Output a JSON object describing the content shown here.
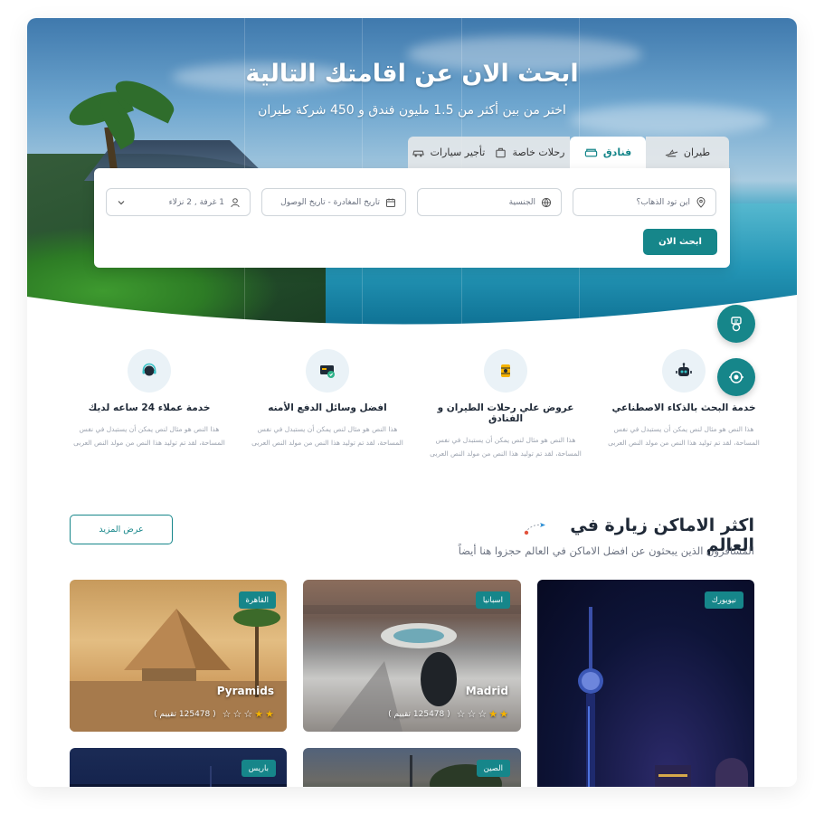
{
  "hero": {
    "title": "ابحث الان عن اقامتك التالية",
    "subtitle": "اختر من بين أكثر من 1.5 مليون فندق و 450 شركة طيران"
  },
  "tabs": [
    {
      "label": "طيران",
      "icon": "plane-icon"
    },
    {
      "label": "فنادق",
      "icon": "hotel-bed-icon",
      "active": true
    },
    {
      "label": "رحلات خاصة",
      "icon": "suitcase-icon"
    },
    {
      "label": "تأجير سيارات",
      "icon": "car-icon"
    }
  ],
  "search": {
    "destination_placeholder": "اين تود الذهاب؟",
    "nationality_placeholder": "الجنسية",
    "dates_placeholder": "تاريخ المغادرة - تاريخ الوصول",
    "rooms_value": "1 غرفة , 2 نزلاء",
    "button_label": "ابحث الان"
  },
  "features": [
    {
      "title": "خدمة البحث بالذكاء الاصطناعي",
      "text": "هذا النص هو مثال لنص يمكن أن يستبدل في نفس المساحة، لقد تم توليد هذا النص من مولد النص العربى",
      "icon": "robot-icon"
    },
    {
      "title": "عروض علي رحلات الطيران و الفنادق",
      "text": "هذا النص هو مثال لنص يمكن أن يستبدل في نفس المساحة، لقد تم توليد هذا النص من مولد النص العربى",
      "icon": "ticket-icon"
    },
    {
      "title": "افضل وسائل الدفع الأمنه",
      "text": "هذا النص هو مثال لنص يمكن أن يستبدل في نفس المساحة، لقد تم توليد هذا النص من مولد النص العربى",
      "icon": "secure-card-icon"
    },
    {
      "title": "خدمة عملاء 24 ساعه لديك",
      "text": "هذا النص هو مثال لنص يمكن أن يستبدل في نفس المساحة، لقد تم توليد هذا النص من مولد النص العربى",
      "icon": "headset-icon"
    }
  ],
  "section": {
    "title": "اكثر الاماكن زيارة في العالم",
    "subtitle": "المسافرون الذين يبحثون عن افضل الاماكن في العالم حجزوا هنا أيضاً",
    "more_button": "عرض المزيد"
  },
  "destinations": [
    {
      "badge": "نيويورك"
    },
    {
      "badge": "اسبانيا",
      "name": "Madrid",
      "rating": 2,
      "reviews": "( 125478 تقييم )"
    },
    {
      "badge": "القاهرة",
      "name": "Pyramids",
      "rating": 2,
      "reviews": "( 125478 تقييم )"
    },
    {
      "badge": "الصين"
    },
    {
      "badge": "باريس"
    }
  ],
  "colors": {
    "accent": "#16868a",
    "heading": "#1f2937",
    "muted": "#9ca3af",
    "star": "#f5b301"
  }
}
